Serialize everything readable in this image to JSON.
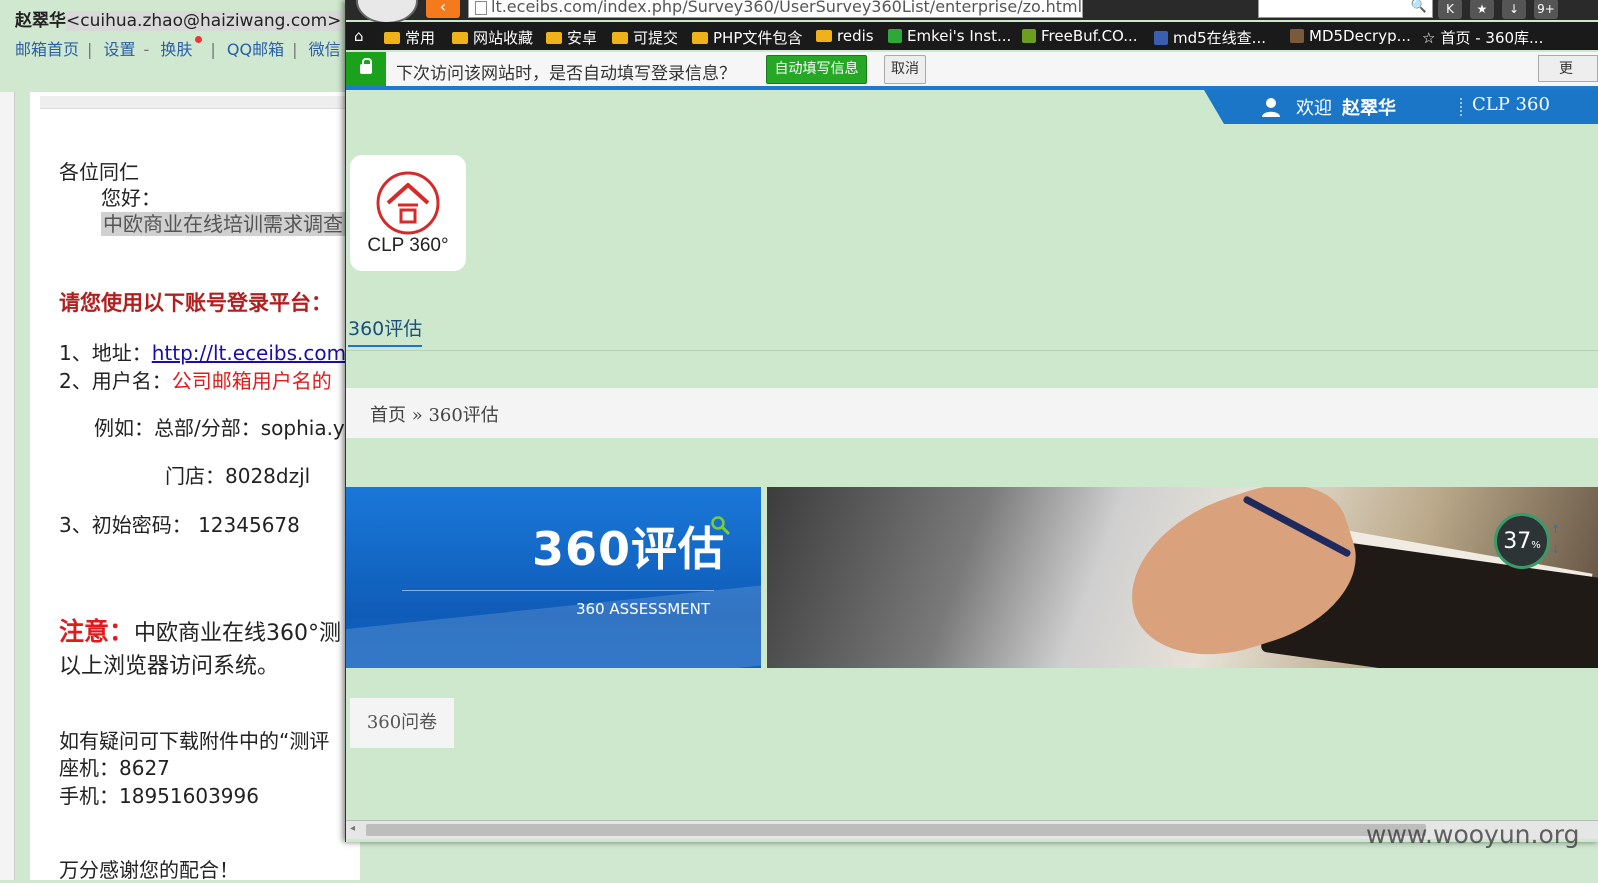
{
  "mail": {
    "user_name": "赵翠华",
    "user_email": "<cuihua.zhao@haiziwang.com>",
    "nav": [
      "邮箱首页",
      "设置",
      "换肤",
      "QQ邮箱",
      "微信"
    ],
    "greeting": "各位同仁",
    "hello": "您好：",
    "subject_line": "中欧商业在线培训需求调查",
    "login_title": "请您使用以下账号登录平台：",
    "address_label": "1、地址：",
    "address_link": "http://lt.eceibs.com",
    "username_label": "2、用户名：",
    "username_value": "公司邮箱用户名的",
    "example_line": "例如：总部/分部：sophia.y",
    "store_line": "门店：8028dzjl",
    "password_line": "3、初始密码： 12345678",
    "note_label": "注意：",
    "note_text": "中欧商业在线360°测",
    "note_text2": "以上浏览器访问系统。",
    "question_line": "如有疑问可下载附件中的“测评",
    "phone_line": "座机：8627",
    "mobile_line": "手机：18951603996",
    "thanks_line": "万分感谢您的配合！"
  },
  "browser": {
    "url": "lt.eceibs.com/index.php/Survey360/UserSurvey360List/enterprise/zo.html",
    "bookmarks": [
      "常用",
      "网站收藏",
      "安卓",
      "可提交",
      "PHP文件包含",
      "redis",
      "Emkei's Inst...",
      "FreeBuf.CO...",
      "md5在线查...",
      "MD5Decryp...",
      "首页 - 360库..."
    ],
    "infobar_text": "下次访问该网站时，是否自动填写登录信息？",
    "autofill_button": "自动填写信息",
    "cancel_button": "取消",
    "more_button": "更"
  },
  "page": {
    "welcome": "欢迎",
    "welcome_user": "赵翠华",
    "brand": "CLP 360",
    "logo_text": "CLP 360°",
    "tab_label": "360评估",
    "breadcrumb": "首页 » 360评估",
    "banner_title": "360评估",
    "banner_subtitle": "360  ASSESSMENT",
    "questionnaire_tab": "360问卷"
  },
  "widget": {
    "percent": "37",
    "unit": "%"
  },
  "watermark": "www.wooyun.org",
  "colors": {
    "page_bg": "#cde8cd",
    "accent_blue": "#1b76c8",
    "autofill_green": "#26a826",
    "logo_red": "#d62a2a"
  }
}
